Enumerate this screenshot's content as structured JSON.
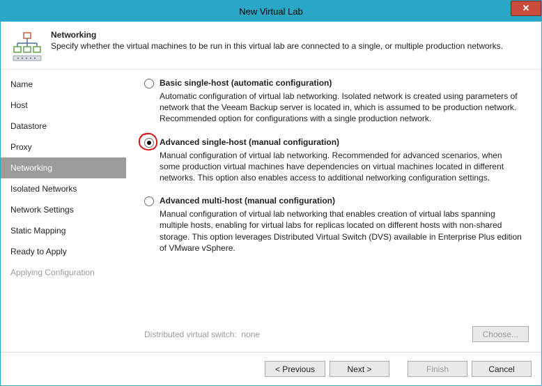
{
  "window": {
    "title": "New Virtual Lab",
    "close_glyph": "✕"
  },
  "header": {
    "title": "Networking",
    "subtitle": "Specify whether the virtual machines to be run in this virtual lab are connected to a single, or multiple production networks."
  },
  "sidebar": {
    "items": [
      {
        "label": "Name"
      },
      {
        "label": "Host"
      },
      {
        "label": "Datastore"
      },
      {
        "label": "Proxy"
      },
      {
        "label": "Networking",
        "selected": true
      },
      {
        "label": "Isolated Networks"
      },
      {
        "label": "Network Settings"
      },
      {
        "label": "Static Mapping"
      },
      {
        "label": "Ready to Apply"
      },
      {
        "label": "Applying Configuration",
        "muted": true
      }
    ]
  },
  "options": [
    {
      "id": "basic-single",
      "title": "Basic single-host (automatic configuration)",
      "desc": "Automatic configuration of virtual lab networking. Isolated network is created using parameters of network that the Veeam Backup server is located in, which is assumed to be production network. Recommended option for configurations with a single production network.",
      "selected": false
    },
    {
      "id": "adv-single",
      "title": "Advanced single-host (manual configuration)",
      "desc": "Manual configuration of virtual lab networking. Recommended for advanced scenarios, when some production virtual machines have dependencies on virtual machines located in different networks. This option also enables access to additional networking configuration settings.",
      "selected": true
    },
    {
      "id": "adv-multi",
      "title": "Advanced multi-host (manual configuration)",
      "desc": "Manual configuration of virtual lab networking that enables creation of virtual labs spanning multiple hosts, enabling for virtual labs for replicas located on different hosts with non-shared storage. This option leverages Distributed Virtual Switch (DVS) available in Enterprise Plus edition of VMware vSphere.",
      "selected": false
    }
  ],
  "dvs": {
    "label": "Distributed virtual switch:",
    "value": "none",
    "choose_label": "Choose..."
  },
  "footer": {
    "previous": "< Previous",
    "next": "Next >",
    "finish": "Finish",
    "cancel": "Cancel"
  },
  "annotation": {
    "color": "#d61414"
  }
}
